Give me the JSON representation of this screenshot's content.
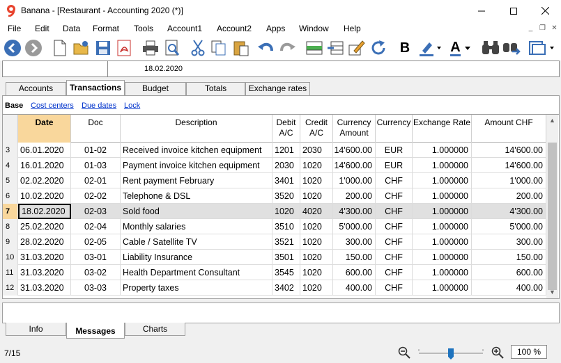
{
  "window": {
    "title": "Banana - [Restaurant - Accounting 2020 (*)]"
  },
  "menu": [
    "File",
    "Edit",
    "Data",
    "Format",
    "Tools",
    "Account1",
    "Account2",
    "Apps",
    "Window",
    "Help"
  ],
  "toolbar": {
    "icons": [
      "back-icon",
      "forward-icon",
      "new-file-icon",
      "open-folder-icon",
      "save-icon",
      "pdf-icon",
      "print-icon",
      "print-preview-icon",
      "cut-icon",
      "copy-icon",
      "paste-icon",
      "undo-icon",
      "redo-icon",
      "add-rows-icon",
      "delete-rows-icon",
      "edit-icon",
      "recheck-icon",
      "bold-icon",
      "highlight-icon",
      "font-color-icon",
      "find-icon",
      "replace-icon",
      "print-view-icon"
    ],
    "bold_label": "B",
    "font_color_label": "A",
    "accent": "#3b6fb6"
  },
  "formula": {
    "value": "18.02.2020"
  },
  "tabs": [
    "Accounts",
    "Transactions",
    "Budget",
    "Totals",
    "Exchange rates"
  ],
  "active_tab": "Transactions",
  "views": [
    "Base",
    "Cost centers",
    "Due dates",
    "Lock"
  ],
  "columns": {
    "date": "Date",
    "doc": "Doc",
    "description": "Description",
    "debit": [
      "Debit",
      "A/C"
    ],
    "credit": [
      "Credit",
      "A/C"
    ],
    "curr_amount": [
      "Currency",
      "Amount"
    ],
    "currency": "Currency",
    "rate": "Exchange Rate",
    "amount": "Amount CHF"
  },
  "rows": [
    {
      "n": "3",
      "date": "06.01.2020",
      "doc": "01-02",
      "desc": "Received invoice kitchen equipment",
      "debit": "1201",
      "credit": "2030",
      "camount": "14'600.00",
      "currency": "EUR",
      "rate": "1.000000",
      "amount": "14'600.00"
    },
    {
      "n": "4",
      "date": "16.01.2020",
      "doc": "01-03",
      "desc": "Payment invoice kitchen equipment",
      "debit": "2030",
      "credit": "1020",
      "camount": "14'600.00",
      "currency": "EUR",
      "rate": "1.000000",
      "amount": "14'600.00"
    },
    {
      "n": "5",
      "date": "02.02.2020",
      "doc": "02-01",
      "desc": "Rent payment February",
      "debit": "3401",
      "credit": "1020",
      "camount": "1'000.00",
      "currency": "CHF",
      "rate": "1.000000",
      "amount": "1'000.00"
    },
    {
      "n": "6",
      "date": "10.02.2020",
      "doc": "02-02",
      "desc": "Telephone & DSL",
      "debit": "3520",
      "credit": "1020",
      "camount": "200.00",
      "currency": "CHF",
      "rate": "1.000000",
      "amount": "200.00"
    },
    {
      "n": "7",
      "date": "18.02.2020",
      "doc": "02-03",
      "desc": "Sold food",
      "debit": "1020",
      "credit": "4020",
      "camount": "4'300.00",
      "currency": "CHF",
      "rate": "1.000000",
      "amount": "4'300.00",
      "selected": true
    },
    {
      "n": "8",
      "date": "25.02.2020",
      "doc": "02-04",
      "desc": "Monthly salaries",
      "debit": "3510",
      "credit": "1020",
      "camount": "5'000.00",
      "currency": "CHF",
      "rate": "1.000000",
      "amount": "5'000.00"
    },
    {
      "n": "9",
      "date": "28.02.2020",
      "doc": "02-05",
      "desc": "Cable / Satellite TV",
      "debit": "3521",
      "credit": "1020",
      "camount": "300.00",
      "currency": "CHF",
      "rate": "1.000000",
      "amount": "300.00"
    },
    {
      "n": "10",
      "date": "31.03.2020",
      "doc": "03-01",
      "desc": "Liability Insurance",
      "debit": "3501",
      "credit": "1020",
      "camount": "150.00",
      "currency": "CHF",
      "rate": "1.000000",
      "amount": "150.00"
    },
    {
      "n": "11",
      "date": "31.03.2020",
      "doc": "03-02",
      "desc": "Health Department Consultant",
      "debit": "3545",
      "credit": "1020",
      "camount": "600.00",
      "currency": "CHF",
      "rate": "1.000000",
      "amount": "600.00"
    },
    {
      "n": "12",
      "date": "31.03.2020",
      "doc": "03-03",
      "desc": "Property taxes",
      "debit": "3402",
      "credit": "1020",
      "camount": "400.00",
      "currency": "CHF",
      "rate": "1.000000",
      "amount": "400.00"
    }
  ],
  "bottom_tabs": [
    "Info",
    "Messages",
    "Charts"
  ],
  "active_bottom_tab": "Messages",
  "status": {
    "text": "7/15",
    "zoom": "100 %"
  }
}
